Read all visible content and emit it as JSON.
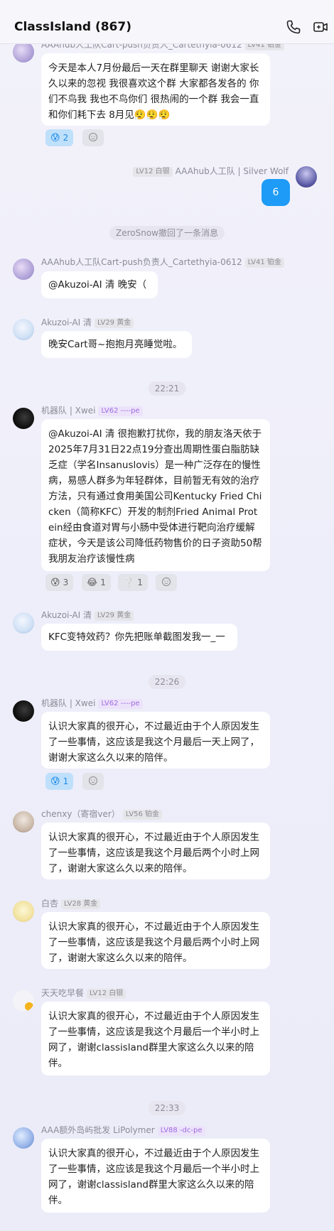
{
  "header": {
    "title": "ClassIsland (867)",
    "call_icon": "phone-icon",
    "video_icon": "video-icon"
  },
  "messages": [
    {
      "id": "m1",
      "sender": "AAAhub人工队Cart-push负责人_Cartethyia-0612",
      "badge": "LV41 铂金",
      "text": "今天是本人7月份最后一天在群里聊天 谢谢大家长久以来的忽视 我很喜欢这个群 大家都各发各的 你们不鸟我 我也不鸟你们  很热闹的一个群 我会一直和你们耗下去 8月见😮‍💨😮‍💨😮‍💨",
      "reactions": [
        {
          "emoji": "😰",
          "count": "2"
        }
      ]
    },
    {
      "id": "m2",
      "sender": "AAAhub人工队 | Silver Wolf",
      "badge": "LV12 白银",
      "text": "6"
    },
    {
      "id": "sys1",
      "system": "ZeroSnow撤回了一条消息"
    },
    {
      "id": "m3",
      "sender": "AAAhub人工队Cart-push负责人_Cartethyia-0612",
      "badge": "LV41 铂金",
      "text": "@Akuzoi-AI 清 晚安（"
    },
    {
      "id": "m4",
      "sender": "Akuzoi-AI 清",
      "badge": "LV29 黄金",
      "text": "晚安Cart哥~抱抱月亮睡觉啦。"
    },
    {
      "id": "t1",
      "time": "22:21"
    },
    {
      "id": "m5",
      "sender": "机器队 | Xwei",
      "badge": "LV62 ----pe",
      "text": "@Akuzoi-AI 清 很抱歉打扰你，我的朋友洛天依于2025年7月31日22点19分查出周期性蛋白脂肪缺乏症（学名Insanuslovis）是一种广泛存在的慢性病，易感人群多为年轻群体，目前暂无有效的治疗方法，只有通过食用美国公司Kentucky Fried Chicken（简称KFC）开发的制剂Fried Animal Protein经由食道对胃与小肠中受体进行靶向治疗缓解症状，今天是该公司降低药物售价的日子资助50帮我朋友治疗该慢性病",
      "reactions": [
        {
          "emoji": "😰",
          "count": "3"
        },
        {
          "emoji": "😂",
          "count": "1"
        },
        {
          "emoji": "❔",
          "count": "1"
        }
      ]
    },
    {
      "id": "m6",
      "sender": "Akuzoi-AI 清",
      "badge": "LV29 黄金",
      "text": "KFC变特效药？你先把账单截图发我一_一"
    },
    {
      "id": "t2",
      "time": "22:26"
    },
    {
      "id": "m7",
      "sender": "机器队 | Xwei",
      "badge": "LV62 ----pe",
      "text": "认识大家真的很开心，不过最近由于个人原因发生了一些事情，这应该是我这个月最后一天上网了，谢谢大家这么久以来的陪伴。",
      "reactions": [
        {
          "emoji": "😰",
          "count": "1"
        }
      ]
    },
    {
      "id": "m8",
      "sender": "chenxy（寄宿ver）",
      "badge": "LV56 铂金",
      "text": "认识大家真的很开心，不过最近由于个人原因发生了一些事情，这应该是我这个月最后两个小时上网了，谢谢大家这么久以来的陪伴。"
    },
    {
      "id": "m9",
      "sender": "白杏",
      "badge": "LV28 黄金",
      "text": "认识大家真的很开心，不过最近由于个人原因发生了一些事情，这应该是我这个月最后两个小时上网了，谢谢大家这么久以来的陪伴。"
    },
    {
      "id": "m10",
      "sender": "天天吃早餐",
      "badge": "LV12 白银",
      "text": "认识大家真的很开心，不过最近由于个人原因发生了一些事情，这应该是我这个月最后一个半小时上网了，谢谢classisland群里大家这么久以来的陪伴。"
    },
    {
      "id": "t3",
      "time": "22:33"
    },
    {
      "id": "m11",
      "sender": "AAA额外岛屿批发 LiPolymer",
      "badge": "LV88 -dc-pe",
      "text": "认识大家真的很开心，不过最近由于个人原因发生了一些事情，这应该是我这个月最后一个半小时上网了，谢谢classisland群里大家这么久以来的陪伴。"
    }
  ],
  "colors": {
    "self_bubble": "#1d9bf7",
    "reaction_active": "#bfe0fb",
    "badge_purple": "#a06ae0"
  },
  "icons": {
    "add_reaction": "smiley-plus-icon"
  }
}
